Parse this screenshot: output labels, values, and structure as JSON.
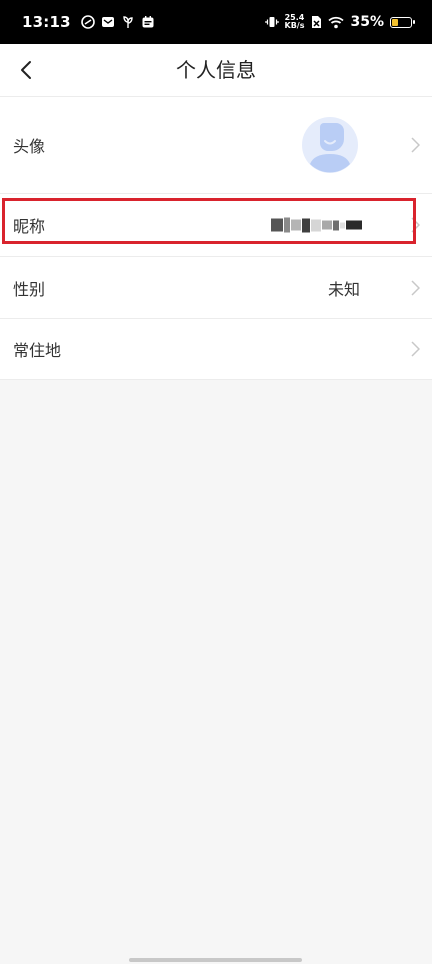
{
  "status_bar": {
    "time": "13:13",
    "net_speed_value": "25.4",
    "net_speed_unit": "KB/s",
    "battery_percent": "35%",
    "battery_level": 0.35
  },
  "header": {
    "title": "个人信息"
  },
  "rows": {
    "avatar": {
      "label": "头像"
    },
    "nickname": {
      "label": "昵称"
    },
    "gender": {
      "label": "性别",
      "value": "未知"
    },
    "location": {
      "label": "常住地"
    }
  },
  "colors": {
    "highlight": "#d9232d",
    "avatar_bg": "#e5ecfb",
    "avatar_fg": "#b9cdf5"
  }
}
